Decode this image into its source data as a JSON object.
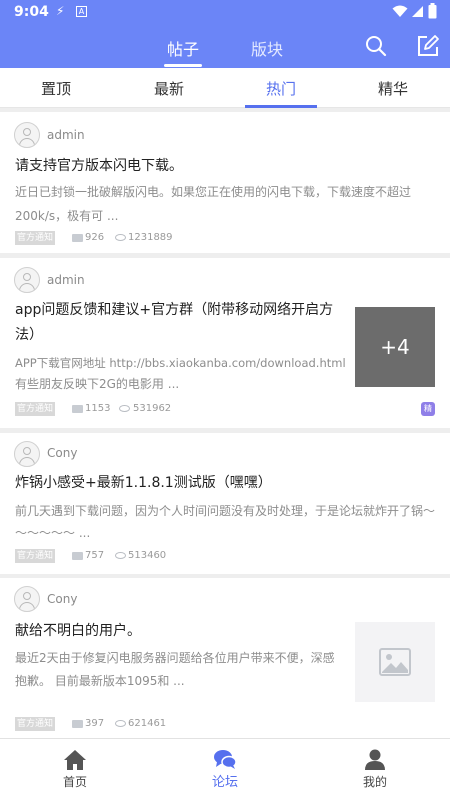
{
  "status_bar": {
    "time": "9:04"
  },
  "top_tabs": [
    {
      "label": "帖子",
      "active": true
    },
    {
      "label": "版块",
      "active": false
    }
  ],
  "sub_tabs": [
    {
      "label": "置顶",
      "active": false
    },
    {
      "label": "最新",
      "active": false
    },
    {
      "label": "热门",
      "active": true
    },
    {
      "label": "精华",
      "active": false
    }
  ],
  "posts": [
    {
      "username": "admin",
      "title": "请支持官方版本闪电下载。",
      "excerpt_lines": [
        "近日已封锁一批破解版闪电。如果您正在使用的闪电下载，下载速度不超过",
        "200k/s，极有可 ..."
      ],
      "badge": "官方通知",
      "comments": "926",
      "views": "1231889"
    },
    {
      "username": "admin",
      "title_lines": [
        "app问题反馈和建议+官方群（附带移动网络开启方",
        "法）"
      ],
      "excerpt_lines": [
        "APP下载官网地址 http://bbs.xiaokanba.com/download.html",
        "有些朋友反映下2G的电影用 ..."
      ],
      "badge": "官方通知",
      "comments": "1153",
      "views": "531962",
      "image_count": "+4",
      "corner_badge": "精"
    },
    {
      "username": "Cony",
      "title": "炸锅小感受+最新1.1.8.1测试版（嘿嘿）",
      "excerpt_lines": [
        "前几天遇到下载问题，因为个人时间问题没有及时处理，于是论坛就炸开了锅～",
        "～～～～～ ..."
      ],
      "badge": "官方通知",
      "comments": "757",
      "views": "513460"
    },
    {
      "username": "Cony",
      "title": "献给不明白的用户。",
      "excerpt_lines": [
        "最近2天由于修复闪电服务器问题给各位用户带来不便，深感",
        "抱歉。 目前最新版本1095和 ..."
      ],
      "badge": "官方通知",
      "comments": "397",
      "views": "621461"
    }
  ],
  "bottom_nav": [
    {
      "label": "首页",
      "icon": "home-icon",
      "active": false
    },
    {
      "label": "论坛",
      "icon": "forum-icon",
      "active": true
    },
    {
      "label": "我的",
      "icon": "profile-icon",
      "active": false
    }
  ],
  "colors": {
    "accent": "#6b85f7",
    "active_text": "#5670ee",
    "badge_purple": "#8f7fe8"
  }
}
